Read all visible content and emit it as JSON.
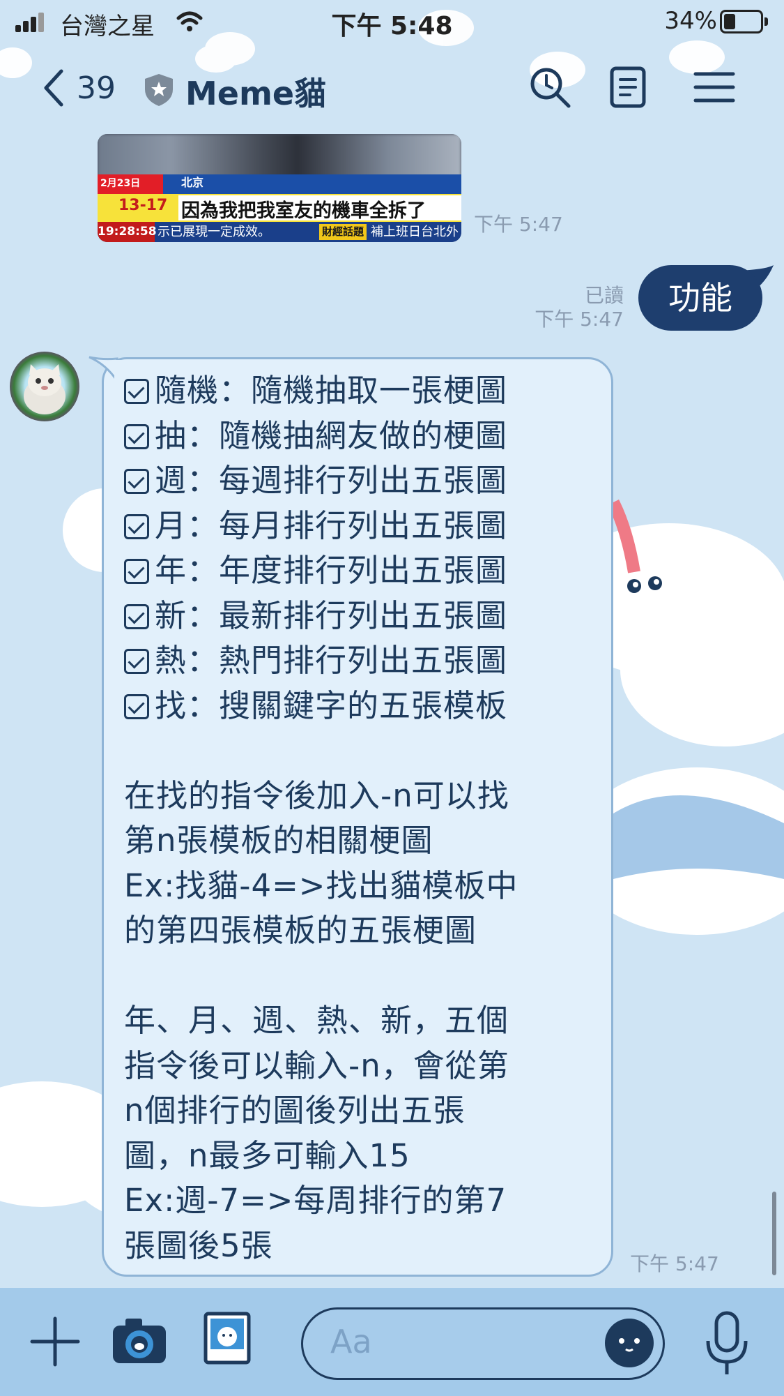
{
  "status_bar": {
    "carrier": "台灣之星",
    "time": "下午 5:48",
    "battery": "34%",
    "battery_level": 0.34
  },
  "header": {
    "back_count": "39",
    "title": "Meme貓"
  },
  "icons": {
    "back": "chevron-left-icon",
    "official": "shield-star-icon",
    "search": "search-icon",
    "notes": "notes-icon",
    "menu": "hamburger-menu-icon",
    "plus": "plus-icon",
    "camera": "camera-icon",
    "sticker": "photo-sticker-icon",
    "emoji": "emoji-icon",
    "mic": "microphone-icon"
  },
  "colors": {
    "outgoing_bubble": "#1e3e6e",
    "incoming_bubble": "#e2f0fb",
    "text_primary": "#1d3a5c",
    "timestamp": "#8a9bb0"
  },
  "messages": [
    {
      "type": "image",
      "direction": "incoming",
      "caption": {
        "headline": "因為我把我室友的機車全拆了",
        "date": "2月23日",
        "location": "北京",
        "temperature": "13-17",
        "ticker_time": "19:28:58",
        "ticker_text": "示已展現一定成效。",
        "ticker_tag": "財經話題",
        "ticker_tail": "補上班日台北外"
      },
      "time": "下午 5:47"
    },
    {
      "type": "text",
      "direction": "outgoing",
      "text": "功能",
      "read": "已讀",
      "time": "下午 5:47"
    },
    {
      "type": "text",
      "direction": "incoming",
      "lines": [
        {
          "check": true,
          "text": "隨機：隨機抽取一張梗圖"
        },
        {
          "check": true,
          "text": "抽：隨機抽網友做的梗圖"
        },
        {
          "check": true,
          "text": "週：每週排行列出五張圖"
        },
        {
          "check": true,
          "text": "月：每月排行列出五張圖"
        },
        {
          "check": true,
          "text": "年：年度排行列出五張圖"
        },
        {
          "check": true,
          "text": "新：最新排行列出五張圖"
        },
        {
          "check": true,
          "text": "熱：熱門排行列出五張圖"
        },
        {
          "check": true,
          "text": "找：搜關鍵字的五張模板"
        },
        {
          "check": false,
          "text": ""
        },
        {
          "check": false,
          "text": "在找的指令後加入-n可以找"
        },
        {
          "check": false,
          "text": "第n張模板的相關梗圖"
        },
        {
          "check": false,
          "text": "Ex:找貓-4=>找出貓模板中"
        },
        {
          "check": false,
          "text": "的第四張模板的五張梗圖"
        },
        {
          "check": false,
          "text": ""
        },
        {
          "check": false,
          "text": "年、月、週、熱、新，五個"
        },
        {
          "check": false,
          "text": "指令後可以輸入-n，會從第"
        },
        {
          "check": false,
          "text": "n個排行的圖後列出五張"
        },
        {
          "check": false,
          "text": "圖，n最多可輸入15"
        },
        {
          "check": false,
          "text": "Ex:週-7=>每周排行的第7"
        },
        {
          "check": false,
          "text": "張圖後5張"
        }
      ],
      "time": "下午 5:47"
    }
  ],
  "input_bar": {
    "placeholder": "Aa"
  }
}
